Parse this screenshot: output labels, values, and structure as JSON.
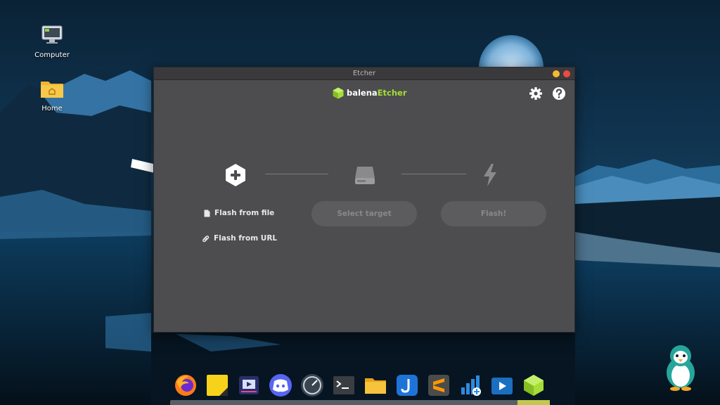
{
  "desktop": {
    "icons": [
      {
        "label": "Computer",
        "icon": "computer-icon"
      },
      {
        "label": "Home",
        "icon": "home-folder-icon"
      }
    ]
  },
  "window": {
    "title": "Etcher",
    "logo_part1": "balena",
    "logo_part2": "Etcher",
    "logo_color": "#a5de37",
    "controls": [
      "minimize-button",
      "close-button"
    ]
  },
  "toolbar": {
    "settings_icon": "gear-icon",
    "help_icon": "help-circle-icon"
  },
  "steps": {
    "flash_from_file": "Flash from file",
    "flash_from_url": "Flash from URL",
    "select_target": "Select target",
    "flash": "Flash!"
  },
  "dock": {
    "apps": [
      "firefox",
      "sticky-notes",
      "video-editor",
      "discord",
      "speed-meter",
      "terminal",
      "files",
      "joplin",
      "sublime-text",
      "network-tool",
      "media-player",
      "balena-etcher"
    ]
  },
  "colors": {
    "window_bg": "#4d4d4f",
    "titlebar_bg": "#3a3a3c",
    "pill_bg": "#5c5c5e",
    "accent_green": "#a5de37",
    "close_red": "#ec4a45",
    "minimize_yellow": "#f5b92f"
  }
}
